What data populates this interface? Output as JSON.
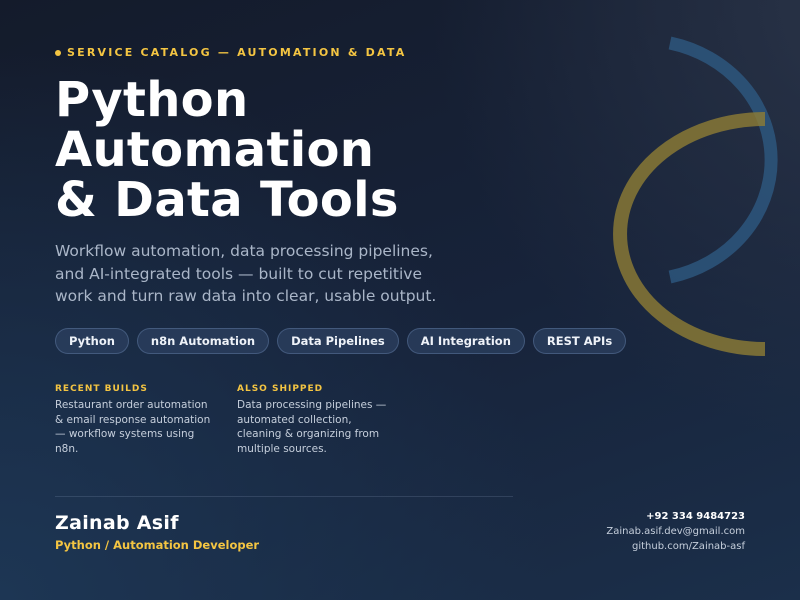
{
  "header": {
    "eyebrow": "SERVICE CATALOG — AUTOMATION & DATA"
  },
  "title": {
    "lines": [
      "Python",
      "Automation",
      "& Data Tools"
    ]
  },
  "subtitle": "Workflow automation, data processing pipelines, and AI-integrated tools — built to cut repetitive work and turn raw data into clear, usable output.",
  "tags": [
    "Python",
    "n8n Automation",
    "Data Pipelines",
    "AI Integration",
    "REST APIs"
  ],
  "sections": {
    "recent": {
      "heading": "RECENT BUILDS",
      "text": "Restaurant order automation & email response automation — workflow systems using n8n."
    },
    "also": {
      "heading": "ALSO SHIPPED",
      "text": "Data processing pipelines — automated collection, cleaning & organizing from multiple sources."
    }
  },
  "author": {
    "name": "Zainab Asif",
    "role": "Python / Automation Developer"
  },
  "contact": {
    "phone": "+92 334 9484723",
    "email": "Zainab.asif.dev@gmail.com",
    "github": "github.com/Zainab-asf"
  },
  "colors": {
    "accent": "#f4c542",
    "arc_blue": "#2f5c86",
    "arc_gold": "#8f7d34",
    "background": "#16213a"
  }
}
